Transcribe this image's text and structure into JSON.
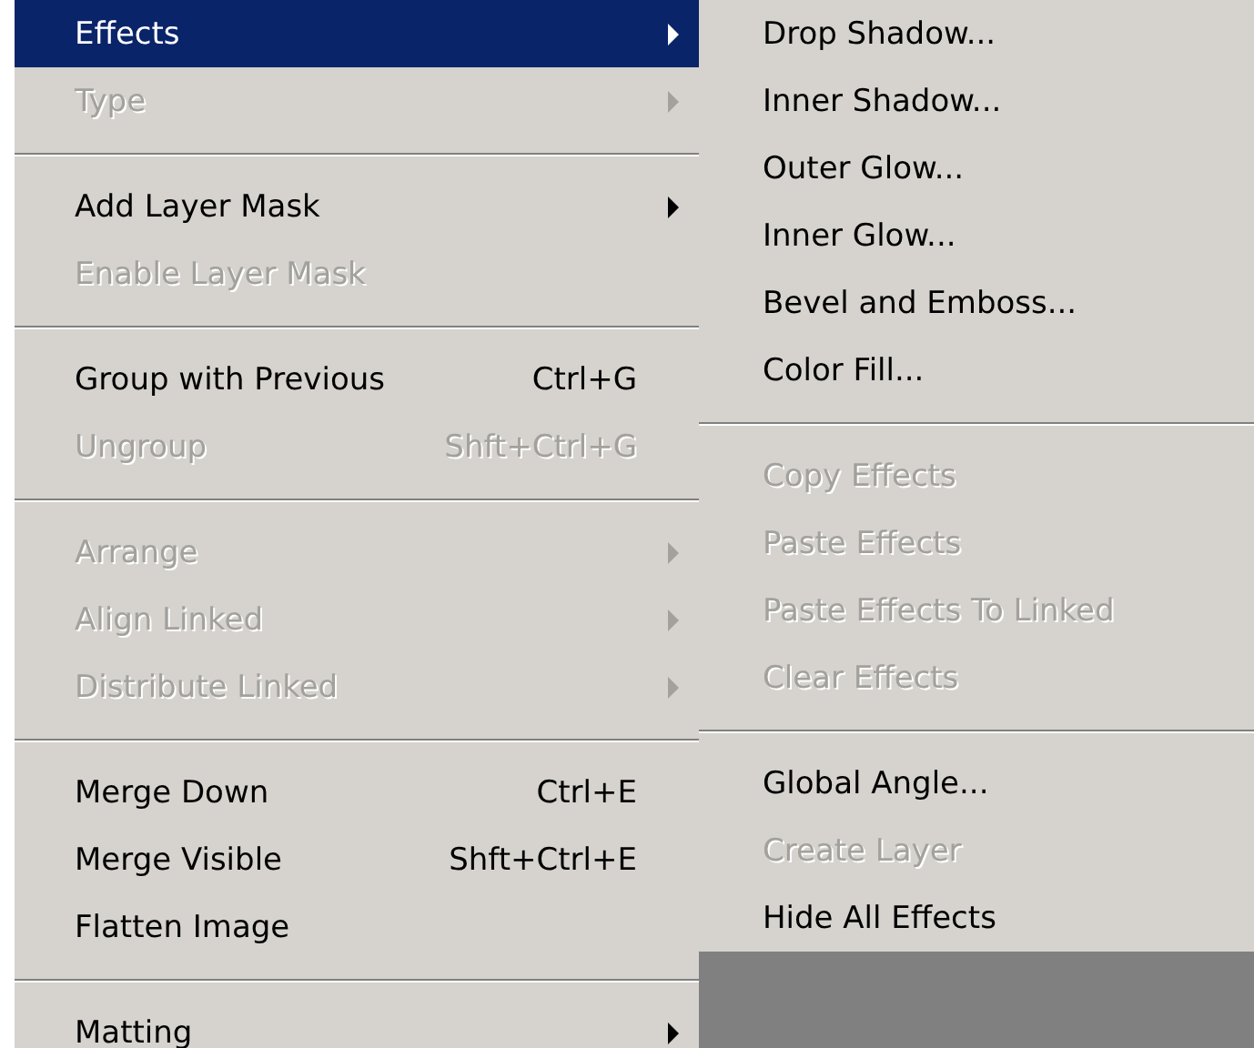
{
  "layer_menu": {
    "items": [
      {
        "kind": "item",
        "label": "Effects",
        "selected": true,
        "disabled": false,
        "submenu": true
      },
      {
        "kind": "item",
        "label": "Type",
        "selected": false,
        "disabled": true,
        "submenu": true
      },
      {
        "kind": "separator"
      },
      {
        "kind": "item",
        "label": "Add Layer Mask",
        "selected": false,
        "disabled": false,
        "submenu": true
      },
      {
        "kind": "item",
        "label": "Enable Layer Mask",
        "selected": false,
        "disabled": true,
        "submenu": false
      },
      {
        "kind": "separator"
      },
      {
        "kind": "item",
        "label": "Group with Previous",
        "shortcut": "Ctrl+G",
        "selected": false,
        "disabled": false,
        "submenu": false
      },
      {
        "kind": "item",
        "label": "Ungroup",
        "shortcut": "Shft+Ctrl+G",
        "selected": false,
        "disabled": true,
        "submenu": false
      },
      {
        "kind": "separator"
      },
      {
        "kind": "item",
        "label": "Arrange",
        "selected": false,
        "disabled": true,
        "submenu": true
      },
      {
        "kind": "item",
        "label": "Align Linked",
        "selected": false,
        "disabled": true,
        "submenu": true
      },
      {
        "kind": "item",
        "label": "Distribute Linked",
        "selected": false,
        "disabled": true,
        "submenu": true
      },
      {
        "kind": "separator"
      },
      {
        "kind": "item",
        "label": "Merge Down",
        "shortcut": "Ctrl+E",
        "selected": false,
        "disabled": false,
        "submenu": false
      },
      {
        "kind": "item",
        "label": "Merge Visible",
        "shortcut": "Shft+Ctrl+E",
        "selected": false,
        "disabled": false,
        "submenu": false
      },
      {
        "kind": "item",
        "label": "Flatten Image",
        "selected": false,
        "disabled": false,
        "submenu": false
      },
      {
        "kind": "separator"
      },
      {
        "kind": "item",
        "label": "Matting",
        "selected": false,
        "disabled": false,
        "submenu": true
      }
    ]
  },
  "effects_submenu": {
    "items": [
      {
        "kind": "item",
        "label": "Drop Shadow...",
        "selected": false,
        "disabled": false,
        "submenu": false
      },
      {
        "kind": "item",
        "label": "Inner Shadow...",
        "selected": false,
        "disabled": false,
        "submenu": false
      },
      {
        "kind": "item",
        "label": "Outer Glow...",
        "selected": false,
        "disabled": false,
        "submenu": false
      },
      {
        "kind": "item",
        "label": "Inner Glow...",
        "selected": false,
        "disabled": false,
        "submenu": false
      },
      {
        "kind": "item",
        "label": "Bevel and Emboss...",
        "selected": false,
        "disabled": false,
        "submenu": false
      },
      {
        "kind": "item",
        "label": "Color Fill...",
        "selected": false,
        "disabled": false,
        "submenu": false
      },
      {
        "kind": "separator"
      },
      {
        "kind": "item",
        "label": "Copy Effects",
        "selected": false,
        "disabled": true,
        "submenu": false
      },
      {
        "kind": "item",
        "label": "Paste Effects",
        "selected": false,
        "disabled": true,
        "submenu": false
      },
      {
        "kind": "item",
        "label": "Paste Effects To Linked",
        "selected": false,
        "disabled": true,
        "submenu": false
      },
      {
        "kind": "item",
        "label": "Clear Effects",
        "selected": false,
        "disabled": true,
        "submenu": false
      },
      {
        "kind": "separator"
      },
      {
        "kind": "item",
        "label": "Global Angle...",
        "selected": false,
        "disabled": false,
        "submenu": false
      },
      {
        "kind": "item",
        "label": "Create Layer",
        "selected": false,
        "disabled": true,
        "submenu": false
      },
      {
        "kind": "item",
        "label": "Hide All Effects",
        "selected": false,
        "disabled": false,
        "submenu": false
      }
    ]
  }
}
